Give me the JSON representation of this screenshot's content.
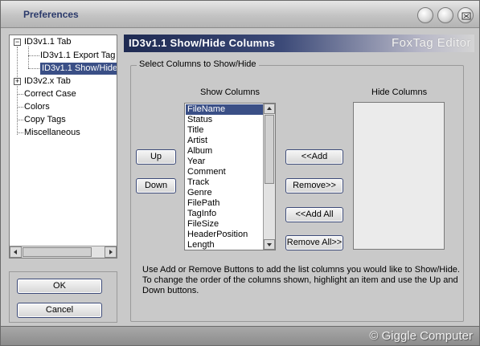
{
  "window": {
    "title": "Preferences"
  },
  "tree": {
    "items": [
      {
        "label": "ID3v1.1 Tab",
        "expander": "−"
      },
      {
        "label": "ID3v1.1 Export Tag"
      },
      {
        "label": "ID3v1.1 Show/Hide"
      },
      {
        "label": "ID3v2.x Tab",
        "expander": "+"
      },
      {
        "label": "Correct Case"
      },
      {
        "label": "Colors"
      },
      {
        "label": "Copy Tags"
      },
      {
        "label": "Miscellaneous"
      }
    ],
    "selected_index": 2
  },
  "buttons": {
    "ok": "OK",
    "cancel": "Cancel"
  },
  "header": {
    "title": "ID3v1.1 Show/Hide Columns",
    "brand": "FoxTag Editor"
  },
  "group": {
    "legend": "Select Columns to Show/Hide"
  },
  "show_columns": {
    "heading": "Show Columns",
    "items": [
      "FileName",
      "Status",
      "Title",
      "Artist",
      "Album",
      "Year",
      "Comment",
      "Track",
      "Genre",
      "FilePath",
      "TagInfo",
      "FileSize",
      "HeaderPosition",
      "Length"
    ],
    "selected_index": 0
  },
  "hide_columns": {
    "heading": "Hide Columns",
    "items": []
  },
  "actions": {
    "up": "Up",
    "down": "Down",
    "add": "<<Add",
    "remove": "Remove>>",
    "add_all": "<<Add All",
    "remove_all": "Remove All>>"
  },
  "help": {
    "line1": "Use Add or Remove Buttons to add the list columns you would like to Show/Hide.",
    "line2": "To change the order of the columns shown, highlight an item and use the Up and",
    "line3": "Down buttons."
  },
  "status": {
    "copyright": "© Giggle Computer"
  },
  "colors": {
    "accent": "#3a4f86",
    "header_dark": "#1e2a52",
    "window_bg": "#c9c9c9"
  }
}
